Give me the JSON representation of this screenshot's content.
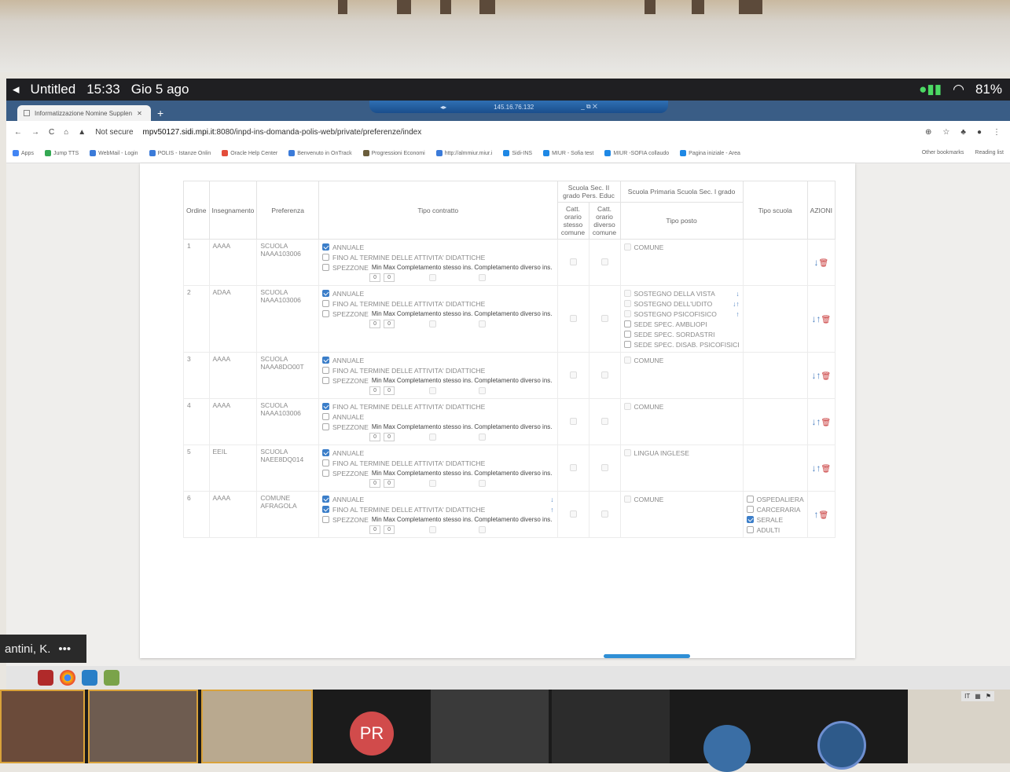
{
  "macbar": {
    "title": "Untitled",
    "time": "15:33",
    "date": "Gio 5 ago",
    "battery": "81%"
  },
  "remote": {
    "left": "◂▸",
    "ip": "145.16.76.132",
    "controls": "_ ⧉ ✕"
  },
  "browser": {
    "tab_title": "Informatizzazione Nomine Supplen",
    "url_warning": "Not secure",
    "url_host": "mpv50127.sidi.mpi.it",
    "url_path": ":8080/inpd-ins-domanda-polis-web/private/preferenze/index",
    "bookmarks": [
      "Apps",
      "Jump TTS",
      "WebMail - Login",
      "POLIS - Istanze Onlin",
      "Oracle Help Center",
      "Benvenuto in OnTrack",
      "Progressioni Economi",
      "http://almmiur.miur.i",
      "Sidi-INS",
      "MIUR - Sofia test",
      "MIUR -SOFIA collaudo",
      "Pagina iniziale - Area"
    ],
    "other_bookmarks": "Other bookmarks",
    "reading_list": "Reading list",
    "bm_colors": [
      "#4285f4",
      "#34a853",
      "#3b7bd9",
      "#3b7bd9",
      "#e34d3b",
      "#3b7bd9",
      "#6b5e3c",
      "#3b7bd9",
      "#1e88e5",
      "#1e88e5",
      "#1e88e5",
      "#1e88e5"
    ]
  },
  "table": {
    "headers": {
      "ordine": "Ordine",
      "insegnamento": "Insegnamento",
      "preferenza": "Preferenza",
      "tipo_contratto": "Tipo contratto",
      "group_sec": "Scuola Sec. II grado Pers. Educ",
      "catt_stesso": "Catt. orario stesso comune",
      "catt_diverso": "Catt. orario diverso comune",
      "group_prim": "Scuola Primaria Scuola Sec. I grado",
      "tipo_posto": "Tipo posto",
      "tipo_scuola": "Tipo scuola",
      "azioni": "AZIONI"
    },
    "spezzone": {
      "label": "SPEZZONE",
      "min": "Min",
      "max": "Max",
      "comp1": "Completamento stesso ins.",
      "comp2": "Completamento diverso ins.",
      "v_min": "0",
      "v_max": "0"
    },
    "rows": [
      {
        "ordine": "1",
        "insegnamento": "AAAA",
        "preferenza": "SCUOLA NAAA103006",
        "contratti": [
          {
            "label": "ANNUALE",
            "checked": true
          },
          {
            "label": "FINO AL TERMINE DELLE ATTIVITA' DIDATTICHE",
            "checked": false
          }
        ],
        "posti": [
          {
            "label": "COMUNE",
            "arrow": ""
          }
        ],
        "scuole": [],
        "azioni": "↓"
      },
      {
        "ordine": "2",
        "insegnamento": "ADAA",
        "preferenza": "SCUOLA NAAA103006",
        "contratti": [
          {
            "label": "ANNUALE",
            "checked": true
          },
          {
            "label": "FINO AL TERMINE DELLE ATTIVITA' DIDATTICHE",
            "checked": false
          }
        ],
        "posti": [
          {
            "label": "SOSTEGNO DELLA VISTA",
            "arrow": "↓"
          },
          {
            "label": "SOSTEGNO DELL'UDITO",
            "arrow": "↓↑"
          },
          {
            "label": "SOSTEGNO PSICOFISICO",
            "arrow": "↑"
          },
          {
            "label": "SEDE SPEC. AMBLIOPI",
            "arrow": ""
          },
          {
            "label": "SEDE SPEC. SORDASTRI",
            "arrow": ""
          },
          {
            "label": "SEDE SPEC. DISAB. PSICOFISICI",
            "arrow": ""
          }
        ],
        "scuole": [],
        "azioni": "↓↑"
      },
      {
        "ordine": "3",
        "insegnamento": "AAAA",
        "preferenza": "SCUOLA NAAA8DO00T",
        "contratti": [
          {
            "label": "ANNUALE",
            "checked": true
          },
          {
            "label": "FINO AL TERMINE DELLE ATTIVITA' DIDATTICHE",
            "checked": false
          }
        ],
        "posti": [
          {
            "label": "COMUNE",
            "arrow": ""
          }
        ],
        "scuole": [],
        "azioni": "↓↑"
      },
      {
        "ordine": "4",
        "insegnamento": "AAAA",
        "preferenza": "SCUOLA NAAA103006",
        "contratti": [
          {
            "label": "FINO AL TERMINE DELLE ATTIVITA' DIDATTICHE",
            "checked": true
          },
          {
            "label": "ANNUALE",
            "checked": false
          }
        ],
        "posti": [
          {
            "label": "COMUNE",
            "arrow": ""
          }
        ],
        "scuole": [],
        "azioni": "↓↑"
      },
      {
        "ordine": "5",
        "insegnamento": "EEIL",
        "preferenza": "SCUOLA NAEE8DQ014",
        "contratti": [
          {
            "label": "ANNUALE",
            "checked": true
          },
          {
            "label": "FINO AL TERMINE DELLE ATTIVITA' DIDATTICHE",
            "checked": false
          }
        ],
        "posti": [
          {
            "label": "LINGUA INGLESE",
            "arrow": ""
          }
        ],
        "scuole": [],
        "azioni": "↓↑"
      },
      {
        "ordine": "6",
        "insegnamento": "AAAA",
        "preferenza": "COMUNE AFRAGOLA",
        "contratti": [
          {
            "label": "ANNUALE",
            "checked": true,
            "arrow": "↓"
          },
          {
            "label": "FINO AL TERMINE DELLE ATTIVITA' DIDATTICHE",
            "checked": true,
            "arrow": "↑"
          }
        ],
        "posti": [
          {
            "label": "COMUNE",
            "arrow": ""
          }
        ],
        "scuole": [
          {
            "label": "OSPEDALIERA",
            "checked": false
          },
          {
            "label": "CARCERARIA",
            "checked": false
          },
          {
            "label": "SERALE",
            "checked": true
          },
          {
            "label": "ADULTI",
            "checked": false
          }
        ],
        "azioni": "↑"
      }
    ]
  },
  "meeting": {
    "username": "antini, K.",
    "more": "•••",
    "avatar1": "PR",
    "tray_lang": "IT"
  },
  "colors": {
    "accent": "#3b7ec9",
    "trash": "#c93a3a",
    "chrome": "#3a5d86"
  }
}
